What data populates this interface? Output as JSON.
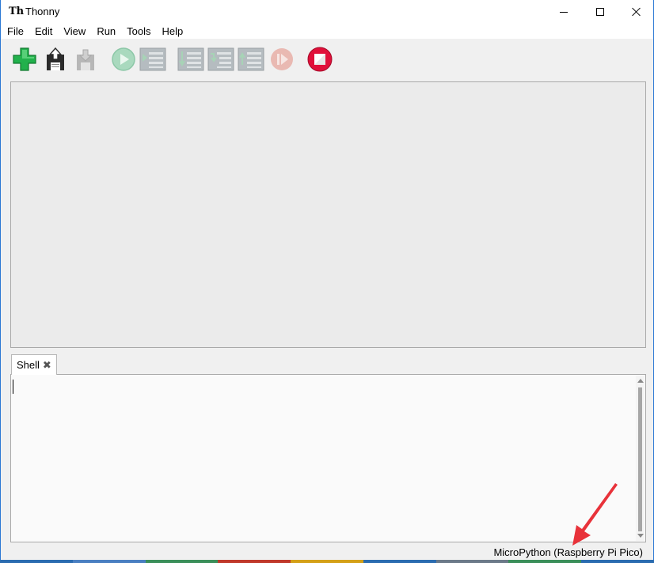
{
  "window": {
    "title": "Thonny",
    "app_icon_text": "Th"
  },
  "menu": {
    "items": [
      "File",
      "Edit",
      "View",
      "Run",
      "Tools",
      "Help"
    ]
  },
  "toolbar": {
    "buttons": [
      {
        "name": "new-file-button",
        "icon": "green-plus-icon",
        "enabled": true
      },
      {
        "name": "open-file-button",
        "icon": "floppy-open-icon",
        "enabled": true
      },
      {
        "name": "save-file-button",
        "icon": "floppy-save-icon",
        "enabled": false
      },
      {
        "name": "run-button",
        "icon": "play-icon",
        "enabled": false
      },
      {
        "name": "debug-button",
        "icon": "debug-list-icon",
        "enabled": false
      },
      {
        "name": "step-over-button",
        "icon": "step-over-icon",
        "enabled": false
      },
      {
        "name": "step-into-button",
        "icon": "step-into-icon",
        "enabled": false
      },
      {
        "name": "step-out-button",
        "icon": "step-out-icon",
        "enabled": false
      },
      {
        "name": "resume-button",
        "icon": "resume-icon",
        "enabled": false
      },
      {
        "name": "stop-button",
        "icon": "stop-icon",
        "enabled": true
      }
    ]
  },
  "shell": {
    "tab_label": "Shell",
    "tab_close_glyph": "✖"
  },
  "status": {
    "interpreter": "MicroPython (Raspberry Pi Pico)"
  },
  "colors": {
    "accent_green": "#22b14c",
    "stop_red": "#e0103a",
    "annotation_red": "#e8323a",
    "disabled_gray": "#a9b0b4"
  }
}
